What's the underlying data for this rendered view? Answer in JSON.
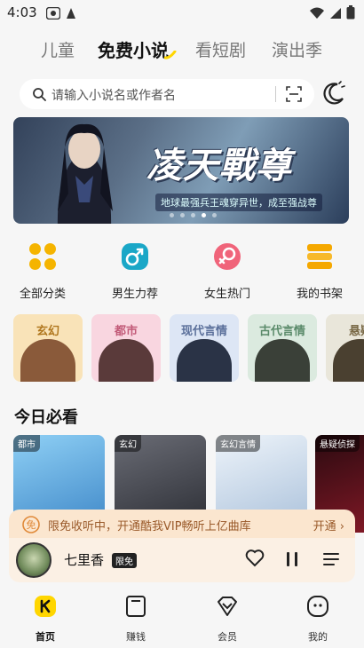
{
  "status_bar": {
    "time": "4:03"
  },
  "top_tabs": [
    {
      "label": "儿童"
    },
    {
      "label": "免费小说",
      "active": true
    },
    {
      "label": "看短剧"
    },
    {
      "label": "演出季"
    }
  ],
  "search": {
    "placeholder": "请输入小说名或作者名"
  },
  "banner": {
    "title": "凌天戰尊",
    "subtitle": "地球最强兵王魂穿异世，成至强战尊",
    "dots_count": 5,
    "active_dot": 3
  },
  "quick_actions": [
    {
      "label": "全部分类",
      "icon": "grid-icon",
      "color": "#f5b400"
    },
    {
      "label": "男生力荐",
      "icon": "male-icon",
      "color": "#1aa7c7"
    },
    {
      "label": "女生热门",
      "icon": "female-icon",
      "color": "#f0647a"
    },
    {
      "label": "我的书架",
      "icon": "bookshelf-icon",
      "color": "#f5a800"
    }
  ],
  "genres": [
    {
      "label": "玄幻",
      "bg": "#f9e3b8",
      "color": "#b0771e"
    },
    {
      "label": "都市",
      "bg": "#f9d6e0",
      "color": "#c25a78"
    },
    {
      "label": "现代言情",
      "bg": "#dde6f5",
      "color": "#5a6f9a"
    },
    {
      "label": "古代言情",
      "bg": "#dbeadf",
      "color": "#5a8a6a"
    },
    {
      "label": "悬疑",
      "bg": "#e9e6da",
      "color": "#7a6a48"
    }
  ],
  "today_section": {
    "title": "今日必看"
  },
  "books": [
    {
      "tag": "都市",
      "bg": "#5aa6e0"
    },
    {
      "tag": "玄幻",
      "bg": "#3d3f46"
    },
    {
      "tag": "玄幻言情",
      "bg": "#c7d8ea"
    },
    {
      "tag": "悬疑侦探",
      "bg": "#6a1320"
    }
  ],
  "vip_banner": {
    "text": "限免收听中，开通酷我VIP畅听上亿曲库",
    "button": "开通 ›",
    "icon_text": "免"
  },
  "player": {
    "song": "七里香",
    "badge": "限免"
  },
  "bottom_nav": [
    {
      "label": "首页",
      "active": true
    },
    {
      "label": "赚钱"
    },
    {
      "label": "会员"
    },
    {
      "label": "我的"
    }
  ],
  "colors": {
    "accent": "#ffd600",
    "text": "#111111"
  }
}
